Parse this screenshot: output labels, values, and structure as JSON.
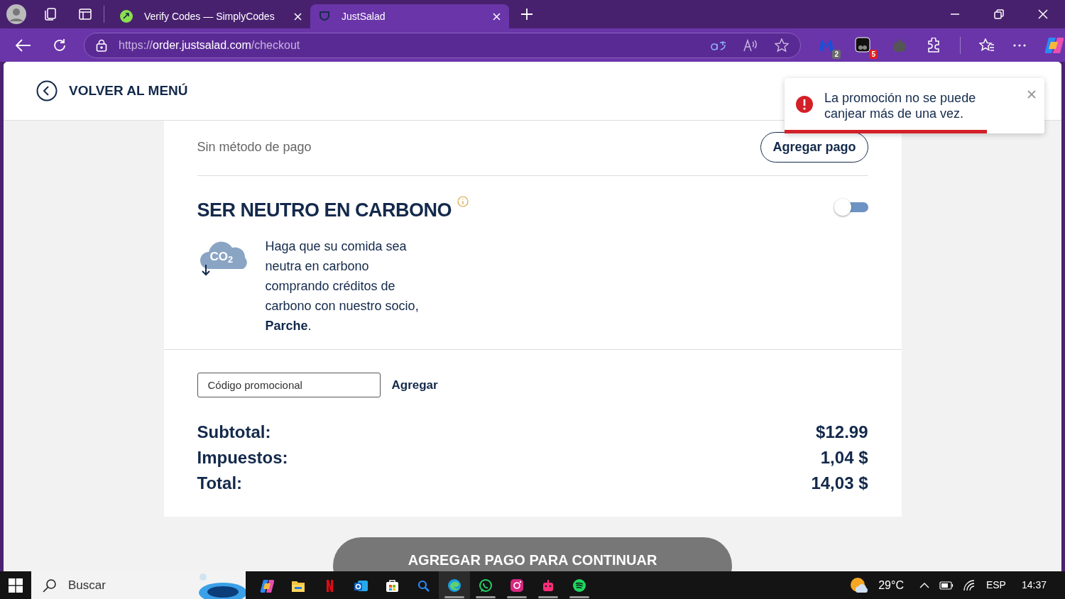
{
  "browser": {
    "tabs": [
      {
        "title": "Verify Codes — SimplyCodes",
        "selected": false
      },
      {
        "title": "JustSalad",
        "selected": true
      }
    ],
    "address": {
      "scheme": "https://",
      "host": "order.justsalad.com",
      "path": "/checkout"
    },
    "extensions": [
      {
        "badge": "2",
        "color": "#6b6b6b"
      },
      {
        "badge": "5",
        "color": "#e02020"
      }
    ]
  },
  "header": {
    "back_label": "VOLVER AL MENÚ"
  },
  "payment": {
    "empty_text": "Sin método de pago",
    "add_button": "Agregar pago"
  },
  "carbon": {
    "title": "SER NEUTRO EN CARBONO",
    "on": false,
    "icon_label": "CO$_{2}$",
    "description": "Haga que su comida sea neutra en carbono comprando créditos de carbono con nuestro socio, **Parche**."
  },
  "promo": {
    "placeholder": "Código promocional",
    "button": "Agregar"
  },
  "totals": [
    {
      "label": "Subtotal:",
      "value": "$12.99"
    },
    {
      "label": "Impuestos:",
      "value": "1,04 $"
    },
    {
      "label": "Total:",
      "value": "14,03 $"
    }
  ],
  "continue_button": "AGREGAR PAGO PARA CONTINUAR",
  "toast": {
    "message": "La promoción no se puede canjear más de una vez.",
    "level": 0.78
  },
  "taskbar": {
    "search_placeholder": "Buscar",
    "apps": [
      {
        "kind": "copilot",
        "running": false
      },
      {
        "kind": "folder",
        "running": false
      },
      {
        "kind": "netflix",
        "running": false
      },
      {
        "kind": "outlook",
        "running": false
      },
      {
        "kind": "store",
        "running": false
      },
      {
        "kind": "search",
        "running": false
      },
      {
        "kind": "edge",
        "running": true
      },
      {
        "kind": "whatsapp",
        "running": true
      },
      {
        "kind": "instagram",
        "running": true
      },
      {
        "kind": "robot",
        "running": true
      },
      {
        "kind": "spotify",
        "running": true
      }
    ],
    "temperature": "29°C",
    "language": "ESP",
    "time": "14:37"
  }
}
